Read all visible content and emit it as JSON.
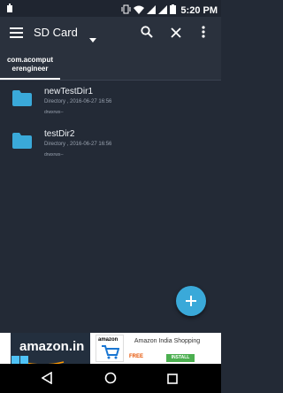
{
  "status_bar": {
    "time": "5:20 PM"
  },
  "toolbar": {
    "title": "SD Card",
    "icons": [
      "menu-icon",
      "dropdown-arrow-icon",
      "search-icon",
      "close-icon",
      "more-vert-icon"
    ]
  },
  "tabs": [
    {
      "label_line1": "com.acomput",
      "label_line2": "erengineer",
      "selected": true
    }
  ],
  "files": [
    {
      "name": "newTestDir1",
      "meta": "Directory , 2016-06-27 16:56",
      "perm": "drwxrwx--"
    },
    {
      "name": "testDir2",
      "meta": "Directory , 2016-06-27 16:56",
      "perm": "drwxrwx--"
    }
  ],
  "ad": {
    "left_logo": "amazon.in",
    "app_icon_text": "amazon",
    "app_title": "Amazon India Shopping",
    "free": "FREE",
    "install": "INSTALL"
  },
  "colors": {
    "accent": "#3aa9d9",
    "background": "#232a36",
    "toolbar": "#2a313d"
  }
}
